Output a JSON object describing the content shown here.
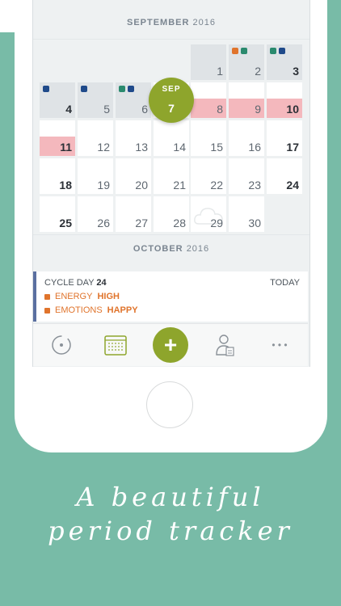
{
  "calendar": {
    "september_label": {
      "month": "SEPTEMBER",
      "year": "2016"
    },
    "october_label": {
      "month": "OCTOBER",
      "year": "2016"
    },
    "today_bubble": {
      "month": "SEP",
      "day": "7"
    },
    "days": [
      "1",
      "2",
      "3",
      "4",
      "5",
      "6",
      "8",
      "9",
      "10",
      "11",
      "12",
      "13",
      "14",
      "15",
      "16",
      "17",
      "18",
      "19",
      "20",
      "21",
      "22",
      "23",
      "24",
      "25",
      "26",
      "27",
      "28",
      "29",
      "30"
    ]
  },
  "info_card": {
    "cycle_label": "CYCLE DAY",
    "cycle_value": "24",
    "today_label": "TODAY",
    "energy_label": "ENERGY",
    "energy_value": "HIGH",
    "emotions_label": "EMOTIONS",
    "emotions_value": "HAPPY"
  },
  "tabbar": {
    "plus": "+",
    "more": "• • •"
  },
  "tagline": {
    "line1": "A beautiful",
    "line2": "period tracker"
  },
  "colors": {
    "accent_green": "#8ea52c",
    "period_pink": "#f4b8bd",
    "dot_navy": "#1f4a8a",
    "dot_teal": "#2a8a6e",
    "dot_orange": "#e0742c",
    "background": "#78bba7"
  }
}
